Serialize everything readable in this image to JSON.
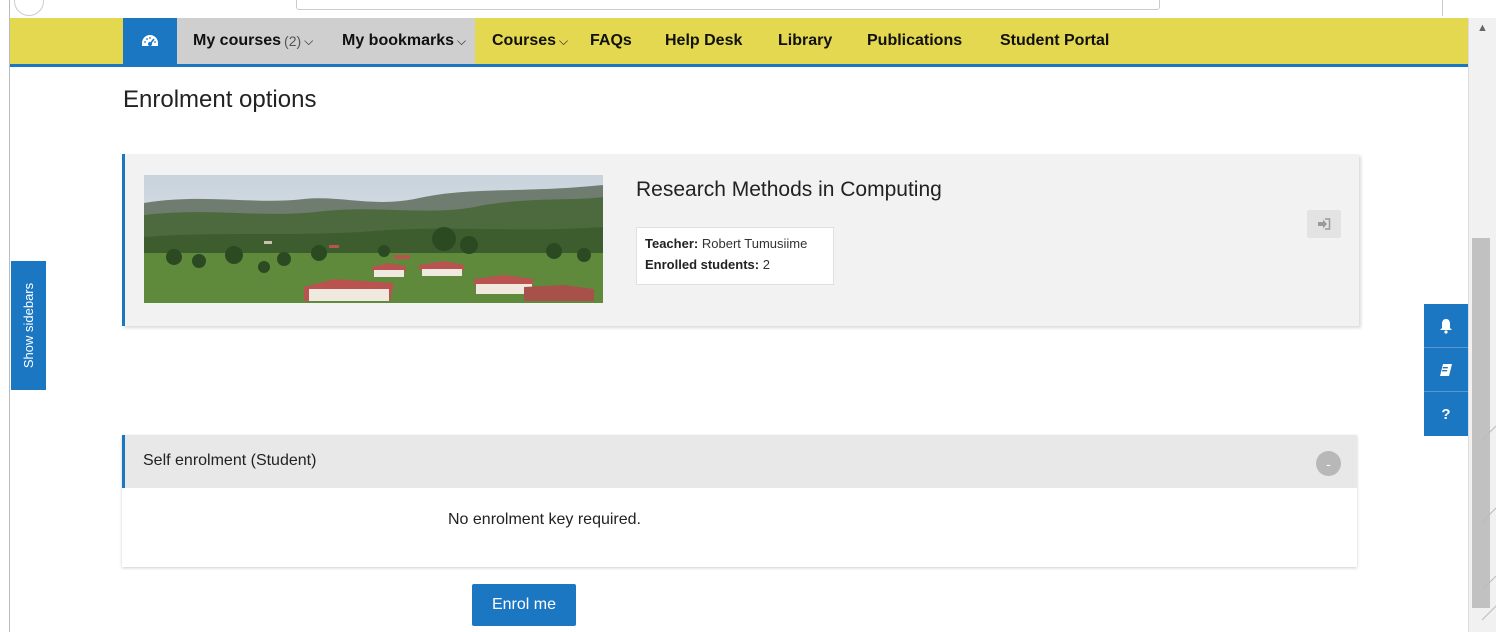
{
  "navbar": {
    "home_icon": "dashboard-icon",
    "items": [
      {
        "label": "My courses",
        "count": "(2)",
        "chevron": "⌵"
      },
      {
        "label": "My bookmarks",
        "chevron": "⌵"
      },
      {
        "label": "Courses",
        "chevron": "⌵"
      },
      {
        "label": "FAQs"
      },
      {
        "label": "Help Desk"
      },
      {
        "label": "Library"
      },
      {
        "label": "Publications"
      },
      {
        "label": "Student Portal"
      }
    ]
  },
  "page": {
    "title": "Enrolment options"
  },
  "course": {
    "name": "Research Methods in Computing",
    "teacher_label": "Teacher:",
    "teacher_name": "Robert Tumusiime",
    "enrolled_label": "Enrolled students:",
    "enrolled_count": "2"
  },
  "sidebar_toggle": {
    "label": "Show sidebars"
  },
  "right_tools": [
    "bell-icon",
    "book-icon",
    "help-icon"
  ],
  "self_enrolment": {
    "title": "Self enrolment (Student)",
    "collapse_label": "-",
    "message": "No enrolment key required.",
    "button_label": "Enrol me"
  },
  "colors": {
    "navbar": "#e3d84f",
    "accent": "#1c77c3"
  }
}
